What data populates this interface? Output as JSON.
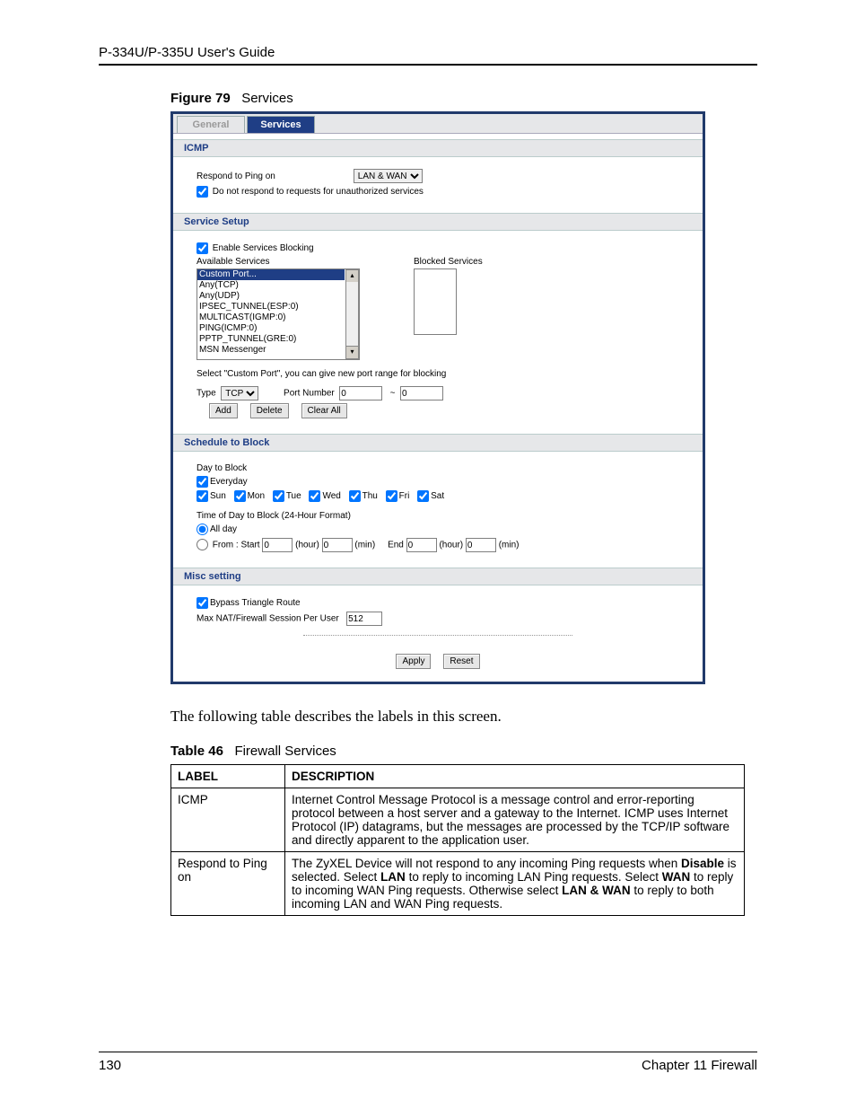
{
  "header": {
    "guide": "P-334U/P-335U User's Guide"
  },
  "figure": {
    "label": "Figure 79",
    "title": "Services"
  },
  "tabs": {
    "general": "General",
    "services": "Services"
  },
  "sections": {
    "icmp": "ICMP",
    "service_setup": "Service Setup",
    "schedule": "Schedule to Block",
    "misc": "Misc setting"
  },
  "icmp": {
    "respond_label": "Respond to Ping on",
    "respond_value": "LAN & WAN",
    "noresp_label": "Do not respond to requests for unauthorized services"
  },
  "svc": {
    "enable_label": "Enable Services Blocking",
    "avail_label": "Available Services",
    "blocked_label": "Blocked Services",
    "items": [
      "Custom Port...",
      "Any(TCP)",
      "Any(UDP)",
      "IPSEC_TUNNEL(ESP:0)",
      "MULTICAST(IGMP:0)",
      "PING(ICMP:0)",
      "PPTP_TUNNEL(GRE:0)",
      "MSN Messenger"
    ],
    "hint": "Select \"Custom Port\", you can give new port range for blocking",
    "type_label": "Type",
    "type_value": "TCP",
    "portnum_label": "Port Number",
    "port_from": "0",
    "tilde": "~",
    "port_to": "0",
    "add": "Add",
    "delete": "Delete",
    "clear": "Clear All"
  },
  "sched": {
    "day_label": "Day to Block",
    "everyday": "Everyday",
    "d0": "Sun",
    "d1": "Mon",
    "d2": "Tue",
    "d3": "Wed",
    "d4": "Thu",
    "d5": "Fri",
    "d6": "Sat",
    "tod_label": "Time of Day to Block (24-Hour Format)",
    "allday": "All day",
    "from_label": "From :   Start",
    "end_label": "End",
    "h": "(hour)",
    "m": "(min)",
    "sh": "0",
    "sm": "0",
    "eh": "0",
    "em": "0"
  },
  "misc": {
    "bypass": "Bypass Triangle Route",
    "maxnat_label": "Max NAT/Firewall Session Per User",
    "maxnat_value": "512"
  },
  "actions": {
    "apply": "Apply",
    "reset": "Reset"
  },
  "body_text": "The following table describes the labels in this screen.",
  "table": {
    "label": "Table 46",
    "title": "Firewall Services",
    "h_label": "LABEL",
    "h_desc": "DESCRIPTION",
    "rows": [
      {
        "label": "ICMP",
        "desc": "Internet Control Message Protocol is a message control and error-reporting protocol between a host server and a gateway to the Internet. ICMP uses Internet Protocol (IP) datagrams, but the messages are processed by the TCP/IP software and directly apparent to the application user."
      },
      {
        "label": "Respond to Ping on",
        "desc_html": "The ZyXEL Device will not respond to any incoming Ping requests when <b>Disable</b> is selected. Select <b>LAN</b> to reply to incoming LAN Ping requests. Select <b>WAN</b> to reply to incoming WAN Ping requests. Otherwise select <b>LAN &amp; WAN</b> to reply to both incoming LAN and WAN Ping requests."
      }
    ]
  },
  "footer": {
    "page": "130",
    "chapter": "Chapter 11 Firewall"
  }
}
